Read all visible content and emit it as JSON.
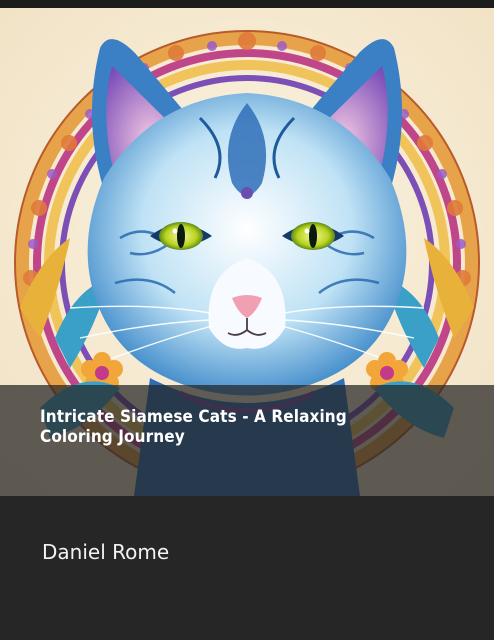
{
  "book": {
    "title": "Intricate Siamese Cats - A Relaxing Coloring Journey",
    "author": "Daniel Rome"
  },
  "colors": {
    "background": "#262626",
    "title_band": "#242424",
    "title_text": "#ffffff",
    "author_text": "#f2f2f2",
    "art_cream": "#f6ecd6",
    "cat_blue": "#3f8fd0",
    "cat_purple": "#6a4fb0",
    "mandala_orange": "#e8963a",
    "eye_green": "#c9d92a"
  },
  "artwork": {
    "icon": "mandala-cat-illustration"
  }
}
